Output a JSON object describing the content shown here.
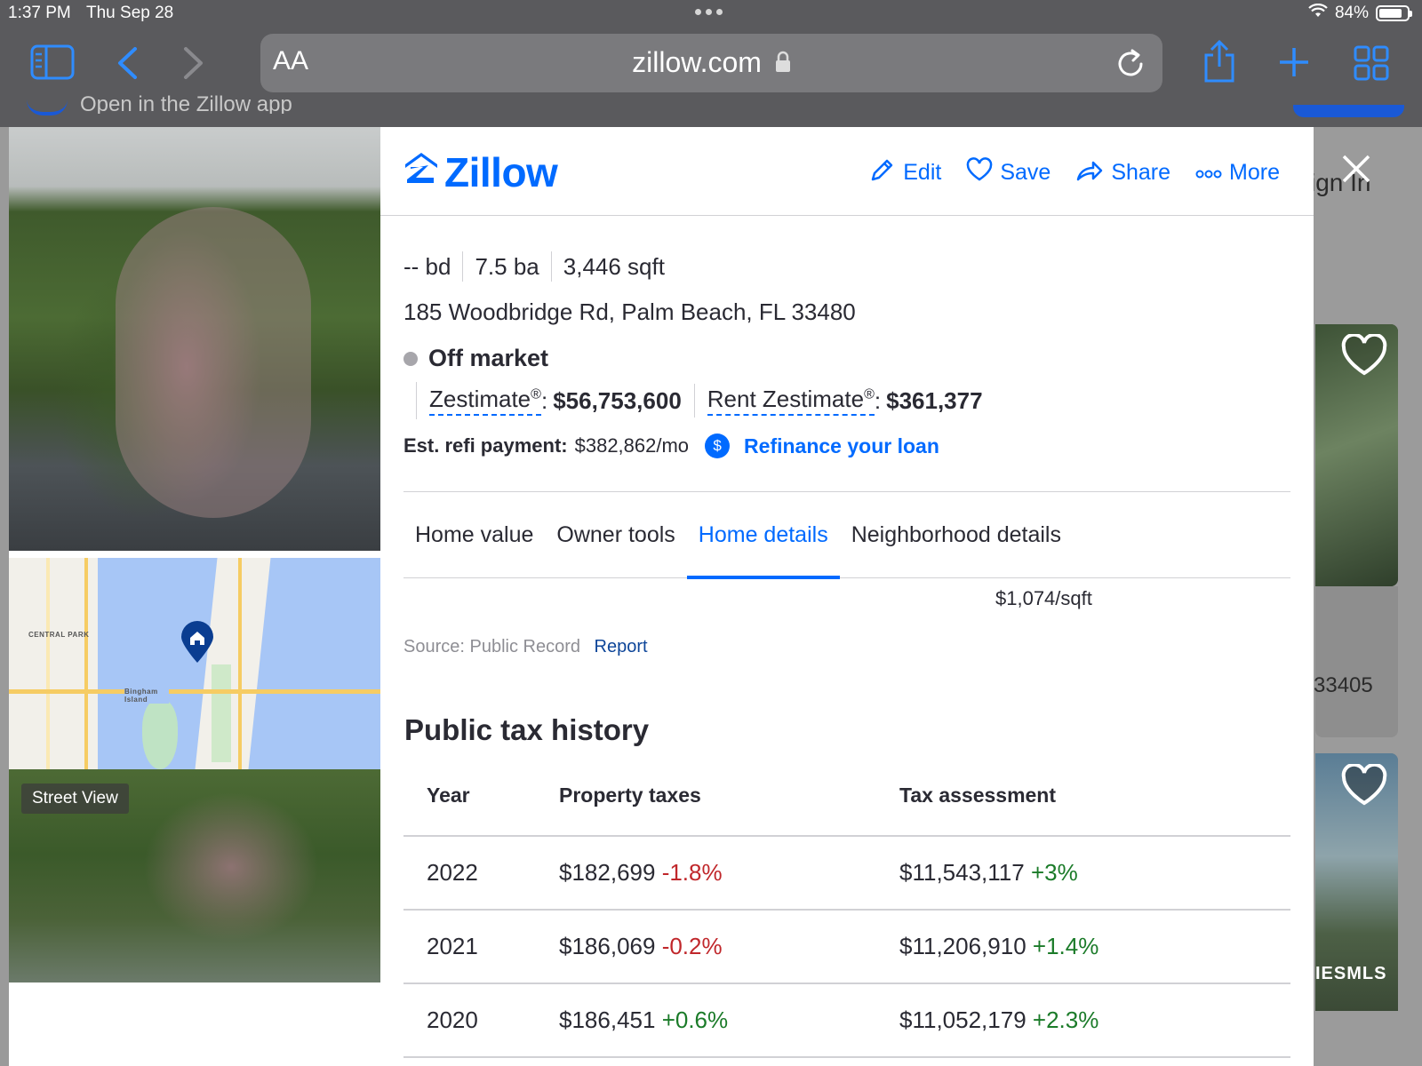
{
  "status_bar": {
    "time": "1:37 PM",
    "date": "Thu Sep 28",
    "battery": "84%",
    "battery_level": 0.84
  },
  "safari": {
    "aa_label": "AA",
    "url": "zillow.com",
    "peek_text": "Open in the Zillow app"
  },
  "background_page": {
    "signin_fragment": "ign In",
    "zip_fragment": "33405",
    "mls_fragment": "IESMLS"
  },
  "media": {
    "street_view_label": "Street View",
    "map_labels": {
      "central_park": "CENTRAL PARK",
      "bingham_island": "Bingham Island"
    }
  },
  "header": {
    "logo": "Zillow",
    "actions": [
      {
        "label": "Edit",
        "icon": "pencil-icon"
      },
      {
        "label": "Save",
        "icon": "heart-icon"
      },
      {
        "label": "Share",
        "icon": "share-icon"
      },
      {
        "label": "More",
        "icon": "more-dots-icon"
      }
    ]
  },
  "listing": {
    "beds": "-- bd",
    "baths": "7.5 ba",
    "sqft": "3,446 sqft",
    "address": "185 Woodbridge Rd, Palm Beach, FL 33480",
    "status": "Off market",
    "zestimate_label": "Zestimate",
    "zestimate_value": "$56,753,600",
    "rent_zestimate_label": "Rent Zestimate",
    "rent_zestimate_value": "$361,377",
    "refi_label": "Est. refi payment:",
    "refi_value": "$382,862/mo",
    "refi_link": "Refinance your loan"
  },
  "tabs": [
    {
      "label": "Home value",
      "active": false
    },
    {
      "label": "Owner tools",
      "active": false
    },
    {
      "label": "Home details",
      "active": true
    },
    {
      "label": "Neighborhood details",
      "active": false
    }
  ],
  "price_per_sqft": "$1,074/sqft",
  "source": {
    "label": "Source: Public Record",
    "link": "Report"
  },
  "tax_history": {
    "title": "Public tax history",
    "columns": [
      "Year",
      "Property taxes",
      "Tax assessment"
    ],
    "rows": [
      {
        "year": "2022",
        "tax": "$182,699",
        "tax_change": "-1.8%",
        "assessment": "$11,543,117",
        "assessment_change": "+3%"
      },
      {
        "year": "2021",
        "tax": "$186,069",
        "tax_change": "-0.2%",
        "assessment": "$11,206,910",
        "assessment_change": "+1.4%"
      },
      {
        "year": "2020",
        "tax": "$186,451",
        "tax_change": "+0.6%",
        "assessment": "$11,052,179",
        "assessment_change": "+2.3%"
      }
    ]
  },
  "colors": {
    "brand_blue": "#006aff",
    "negative": "#c0272b",
    "positive": "#1b7b29"
  }
}
